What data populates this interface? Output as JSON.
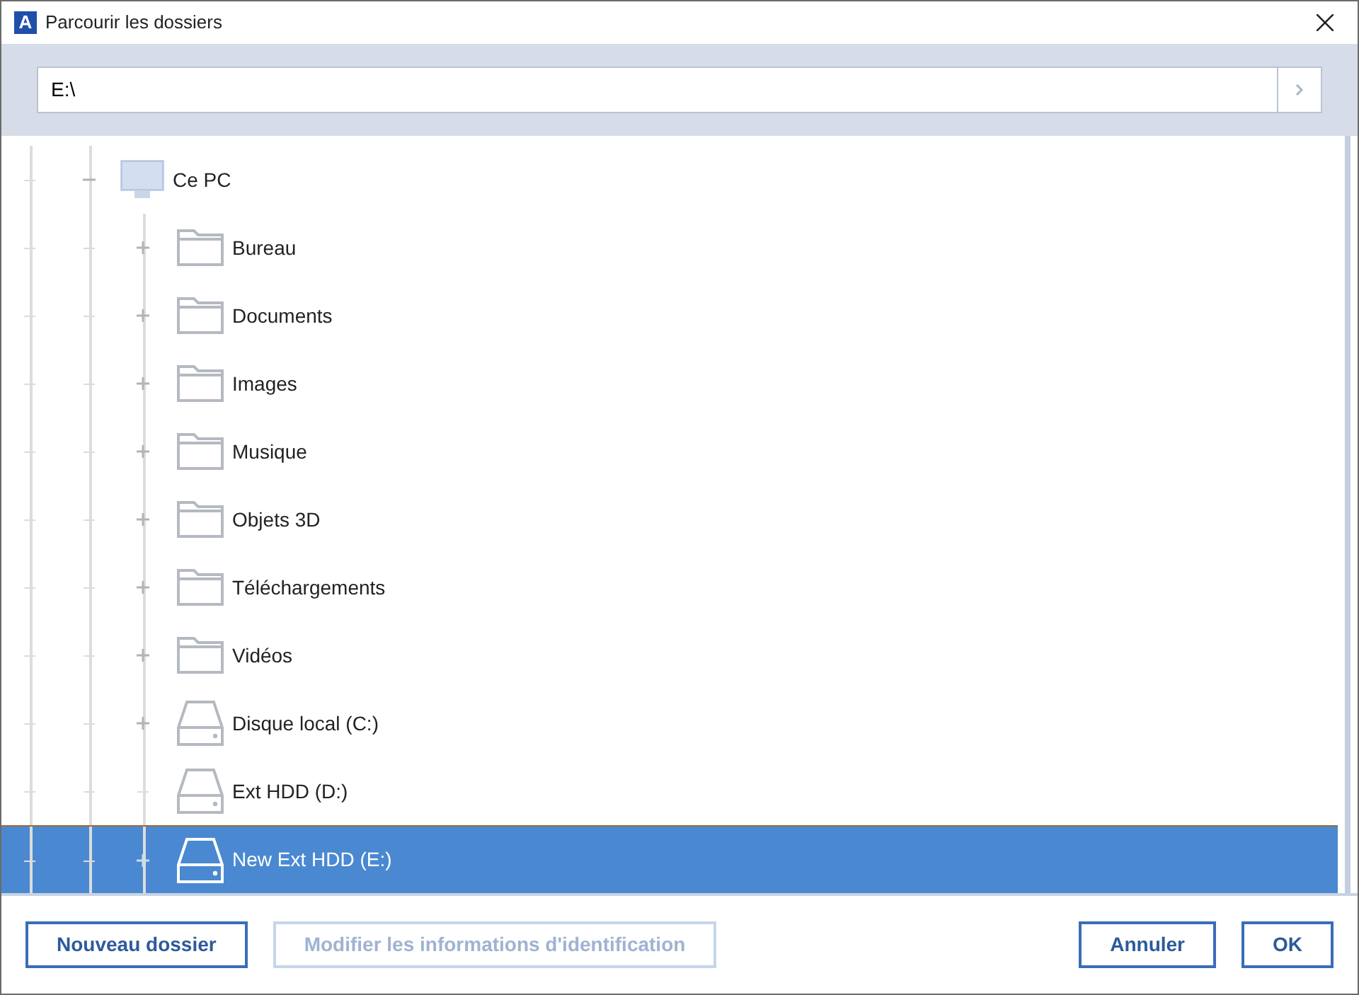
{
  "window": {
    "title": "Parcourir les dossiers",
    "logo_text": "A"
  },
  "path_field": {
    "value": "E:\\"
  },
  "tree": [
    {
      "label": "Ce PC",
      "kind": "computer",
      "expanded": true,
      "selected": false,
      "children": [
        {
          "label": "Bureau",
          "kind": "folder",
          "expandable": true,
          "selected": false
        },
        {
          "label": "Documents",
          "kind": "folder",
          "expandable": true,
          "selected": false
        },
        {
          "label": "Images",
          "kind": "folder",
          "expandable": true,
          "selected": false
        },
        {
          "label": "Musique",
          "kind": "folder",
          "expandable": true,
          "selected": false
        },
        {
          "label": "Objets 3D",
          "kind": "folder",
          "expandable": true,
          "selected": false
        },
        {
          "label": "Téléchargements",
          "kind": "folder",
          "expandable": true,
          "selected": false
        },
        {
          "label": "Vidéos",
          "kind": "folder",
          "expandable": true,
          "selected": false
        },
        {
          "label": "Disque local (C:)",
          "kind": "drive",
          "expandable": true,
          "selected": false
        },
        {
          "label": "Ext HDD (D:)",
          "kind": "drive",
          "expandable": false,
          "selected": false
        },
        {
          "label": "New Ext HDD (E:)",
          "kind": "drive",
          "expandable": true,
          "selected": true
        }
      ]
    }
  ],
  "buttons": [
    {
      "label": "Nouveau dossier",
      "disabled": false
    },
    {
      "label": "Modifier les informations d'identification",
      "disabled": true
    },
    {
      "label": "Annuler",
      "disabled": false
    },
    {
      "label": "OK",
      "disabled": false
    }
  ]
}
